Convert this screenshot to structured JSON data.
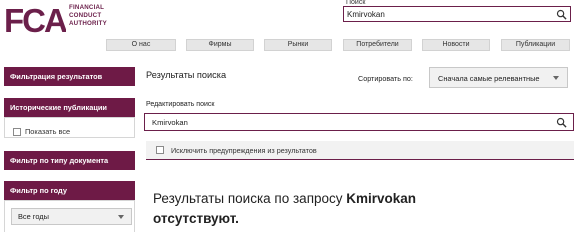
{
  "brand": {
    "logo_text": "FCA",
    "line1": "FINANCIAL",
    "line2": "CONDUCT",
    "line3": "AUTHORITY",
    "color": "#6b1f4a"
  },
  "search": {
    "label": "Поиск",
    "value": "Kmirvokan"
  },
  "nav": {
    "items": [
      "О нас",
      "Фирмы",
      "Рынки",
      "Потребители",
      "Новости",
      "Публикации"
    ]
  },
  "sidebar": {
    "filter_results": "Фильтрация результатов",
    "historic": "Исторические публикации",
    "show_all": "Показать все",
    "by_doc_type": "Фильтр по типу документа",
    "by_year": "Фильтр по году",
    "year_select": "Все годы"
  },
  "main": {
    "title": "Результаты поиска",
    "sort_label": "Сортировать по:",
    "sort_value": "Сначала самые релевантные",
    "edit_label": "Редактировать поиск",
    "edit_value": "Kmirvokan",
    "exclude_label": "Исключить предупреждения из результатов",
    "noresult_prefix": "Результаты поиска по запросу ",
    "noresult_query": "Kmirvokan",
    "noresult_suffix": "отсутствуют."
  }
}
